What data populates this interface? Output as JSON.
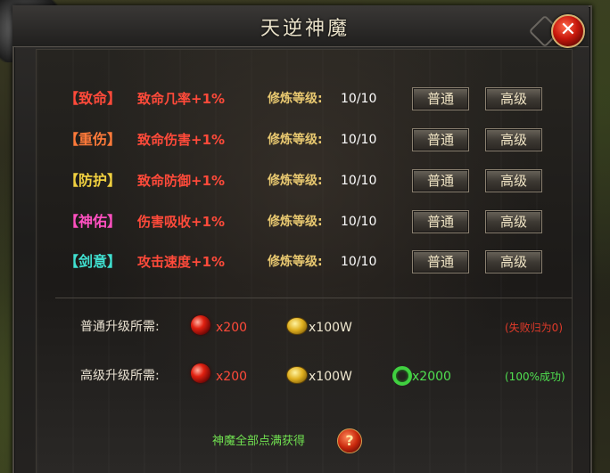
{
  "window": {
    "title": "天逆神魔",
    "close_label": "✕"
  },
  "rows": [
    {
      "tag": "【致命】",
      "effect": "致命几率+1%",
      "level_label": "修炼等级:",
      "level_value": "10/10",
      "btn_normal": "普通",
      "btn_advanced": "高级",
      "tag_color": "#ff4a3a"
    },
    {
      "tag": "【重伤】",
      "effect": "致命伤害+1%",
      "level_label": "修炼等级:",
      "level_value": "10/10",
      "btn_normal": "普通",
      "btn_advanced": "高级",
      "tag_color": "#ff7a3a"
    },
    {
      "tag": "【防护】",
      "effect": "致命防御+1%",
      "level_label": "修炼等级:",
      "level_value": "10/10",
      "btn_normal": "普通",
      "btn_advanced": "高级",
      "tag_color": "#f0d040"
    },
    {
      "tag": "【神佑】",
      "effect": "伤害吸收+1%",
      "level_label": "修炼等级:",
      "level_value": "10/10",
      "btn_normal": "普通",
      "btn_advanced": "高级",
      "tag_color": "#ff50c0"
    },
    {
      "tag": "【剑意】",
      "effect": "攻击速度+1%",
      "level_label": "修炼等级:",
      "level_value": "10/10",
      "btn_normal": "普通",
      "btn_advanced": "高级",
      "tag_color": "#40e0d0"
    }
  ],
  "requirements": {
    "normal": {
      "label": "普通升级所需:",
      "orb_amount": "x200",
      "gold_amount": "x100W",
      "note": "(失败归为0)"
    },
    "advanced": {
      "label": "高级升级所需:",
      "orb_amount": "x200",
      "gold_amount": "x100W",
      "ring_amount": "x2000",
      "note": "(100%成功)"
    }
  },
  "footer": {
    "text": "神魔全部点满获得",
    "help_label": "?"
  },
  "colors": {
    "effect_red": "#ff4a3a",
    "note_red": "#e03a2a",
    "note_green": "#50e050",
    "gold_text": "#e8c870"
  }
}
